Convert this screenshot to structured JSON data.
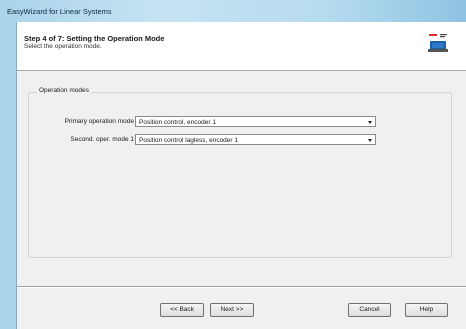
{
  "window": {
    "title": "EasyWizard for Linear Systems"
  },
  "header": {
    "step_title": "Step 4 of 7: Setting the Operation Mode",
    "step_description": "Select the operation mode."
  },
  "operation_modes": {
    "legend": "Operation modes",
    "primary": {
      "label": "Primary operation mode",
      "value": "Position control, encoder 1"
    },
    "secondary": {
      "label": "Second. oper. mode 1",
      "value": "Position control lagless, encoder 1"
    }
  },
  "buttons": {
    "back": "<< Back",
    "next": "Next >>",
    "cancel": "Cancel",
    "help": "Help"
  },
  "colors": {
    "desktop_gradient": "#b6dbef",
    "dialog_bg": "#f0f0f0",
    "icon_red": "#e0322b",
    "icon_blue": "#1c5ea8"
  },
  "icons": {
    "wizard": "drive-wizard-icon",
    "dropdown": "chevron-down-icon"
  }
}
